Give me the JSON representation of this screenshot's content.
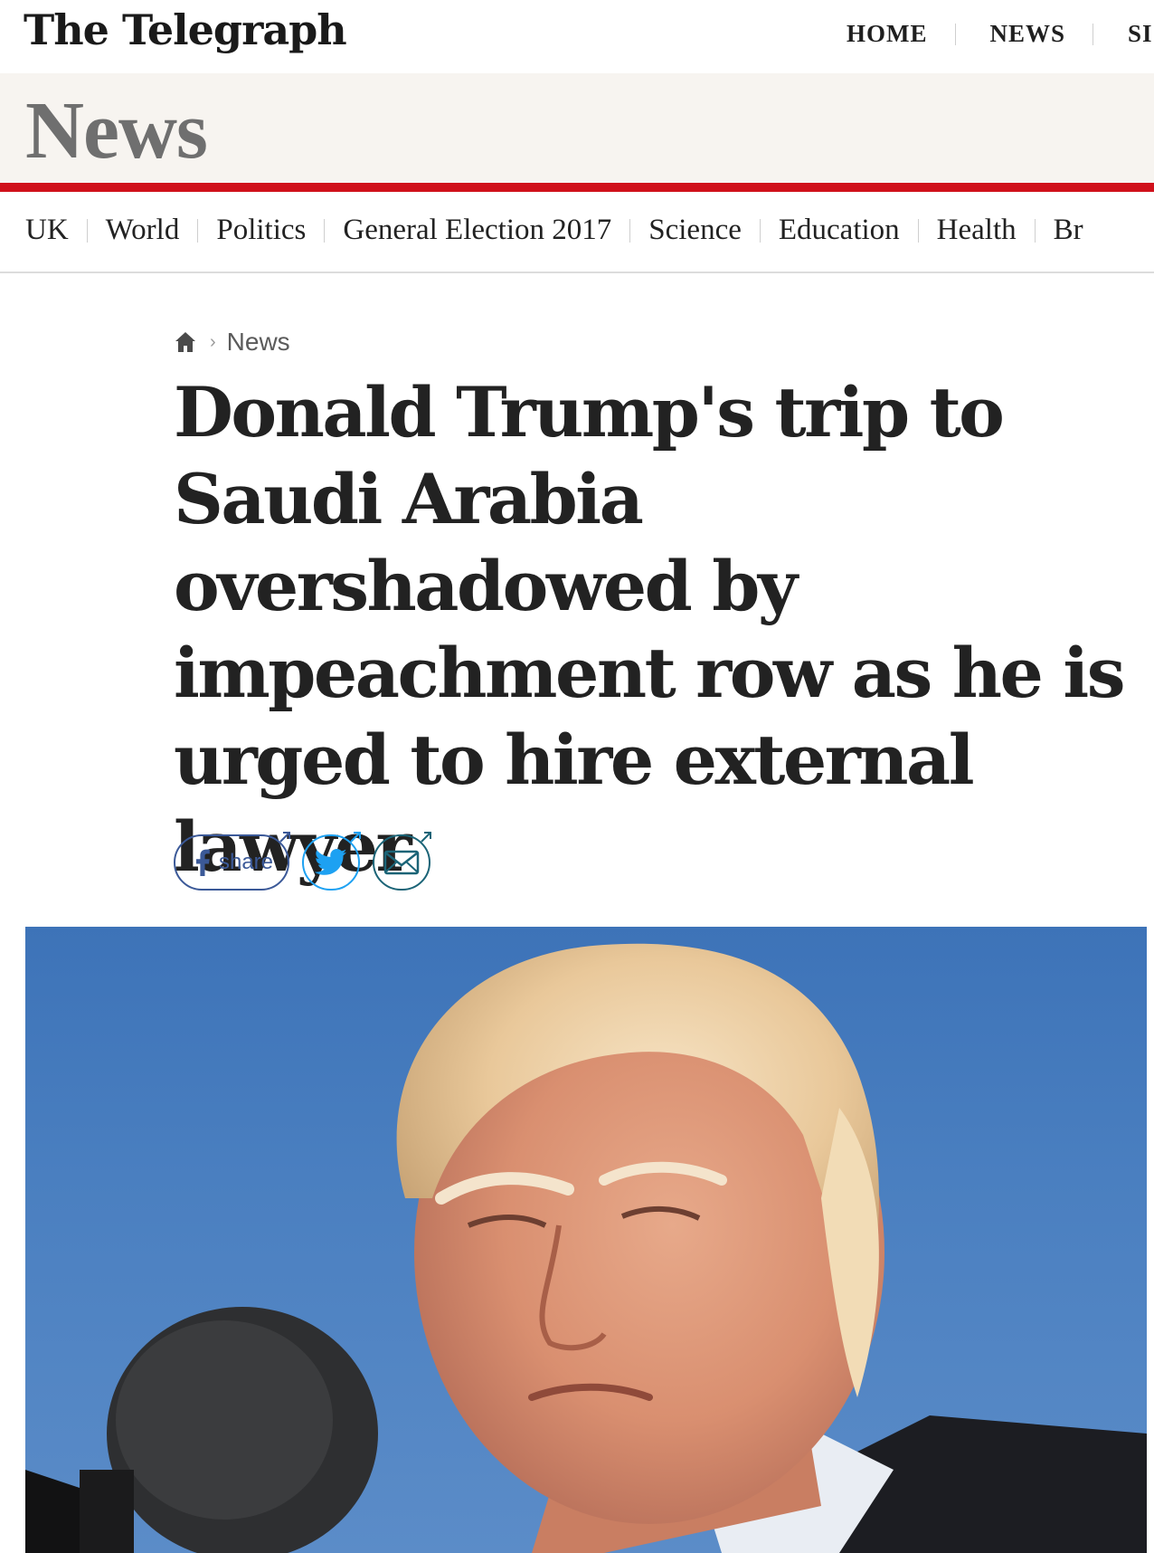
{
  "masthead": {
    "logo_text": "The Telegraph",
    "top_nav": [
      "HOME",
      "NEWS",
      "SI"
    ]
  },
  "section": {
    "title": "News",
    "accent_color": "#d0111b",
    "band_color": "#f7f4f0"
  },
  "subnav": {
    "items": [
      "UK",
      "World",
      "Politics",
      "General Election 2017",
      "Science",
      "Education",
      "Health",
      "Br"
    ]
  },
  "breadcrumb": {
    "home_icon": "home-icon",
    "link": "News"
  },
  "article": {
    "headline": "Donald Trump's trip to Saudi Arabia overshadowed by impeachment row as he is urged to hire external lawyer"
  },
  "share": {
    "facebook_label": "share",
    "facebook_icon": "facebook-icon",
    "twitter_icon": "twitter-icon",
    "email_icon": "email-icon",
    "colors": {
      "facebook": "#3b5998",
      "twitter": "#1da1f2",
      "email": "#1b6477"
    }
  },
  "hero": {
    "subject": "photo"
  }
}
